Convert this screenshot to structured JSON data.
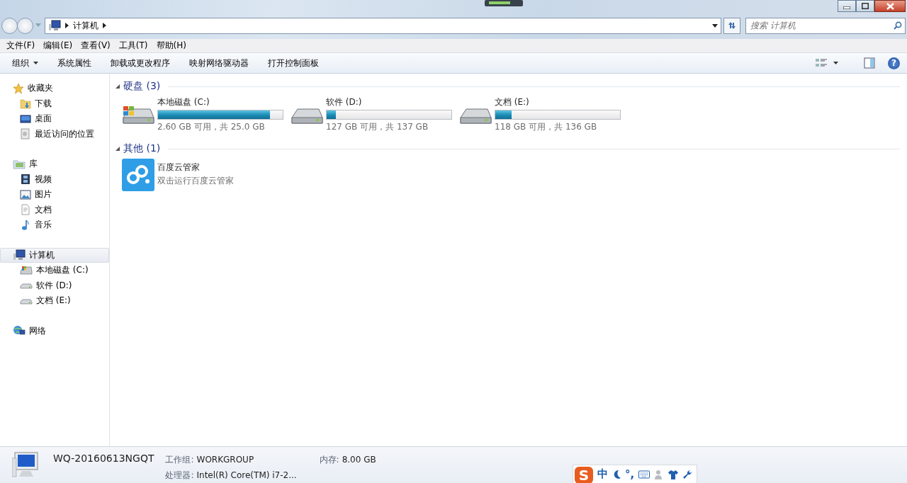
{
  "address": {
    "crumbs": [
      "计算机"
    ],
    "search_placeholder": "搜索 计算机"
  },
  "menu": [
    "文件(F)",
    "编辑(E)",
    "查看(V)",
    "工具(T)",
    "帮助(H)"
  ],
  "toolbar": {
    "buttons": [
      {
        "label": "组织",
        "dropdown": true
      },
      {
        "label": "系统属性",
        "dropdown": false
      },
      {
        "label": "卸载或更改程序",
        "dropdown": false
      },
      {
        "label": "映射网络驱动器",
        "dropdown": false
      },
      {
        "label": "打开控制面板",
        "dropdown": false
      }
    ],
    "help": "?"
  },
  "sidebar": [
    {
      "label": "收藏夹",
      "selected": false,
      "children": [
        {
          "label": "下载",
          "selected": false
        },
        {
          "label": "桌面",
          "selected": false
        },
        {
          "label": "最近访问的位置",
          "selected": false
        }
      ]
    },
    {
      "label": "库",
      "selected": false,
      "children": [
        {
          "label": "视频",
          "selected": false
        },
        {
          "label": "图片",
          "selected": false
        },
        {
          "label": "文档",
          "selected": false
        },
        {
          "label": "音乐",
          "selected": false
        }
      ]
    },
    {
      "label": "计算机",
      "selected": true,
      "children": [
        {
          "label": "本地磁盘 (C:)",
          "selected": false
        },
        {
          "label": "软件 (D:)",
          "selected": false
        },
        {
          "label": "文档 (E:)",
          "selected": false
        }
      ]
    },
    {
      "label": "网络",
      "selected": false
    }
  ],
  "groups": [
    {
      "label": "硬盘 (3)",
      "expanded": true,
      "items": [
        {
          "kind": "drive",
          "name": "本地磁盘 (C:)",
          "level": 0.896,
          "info": "2.60 GB 可用，共 25.0 GB"
        },
        {
          "kind": "drive",
          "name": "软件 (D:)",
          "level": 0.073,
          "info": "127 GB 可用，共 137 GB"
        },
        {
          "kind": "drive",
          "name": "文档 (E:)",
          "level": 0.132,
          "info": "118 GB 可用，共 136 GB"
        }
      ]
    },
    {
      "label": "其他 (1)",
      "expanded": true,
      "items": [
        {
          "kind": "app",
          "name": "百度云管家",
          "info": "双击运行百度云管家"
        }
      ]
    }
  ],
  "details": {
    "name": "WQ-20160613NGQT",
    "fields": [
      {
        "label": "工作组:",
        "value": "WORKGROUP"
      },
      {
        "label": "内存:",
        "value": "8.00 GB"
      },
      {
        "label": "处理器:",
        "value": "Intel(R) Core(TM) i7-2..."
      }
    ]
  },
  "ime": {
    "logo": "S",
    "mode": "中",
    "punctuation": "°,"
  }
}
